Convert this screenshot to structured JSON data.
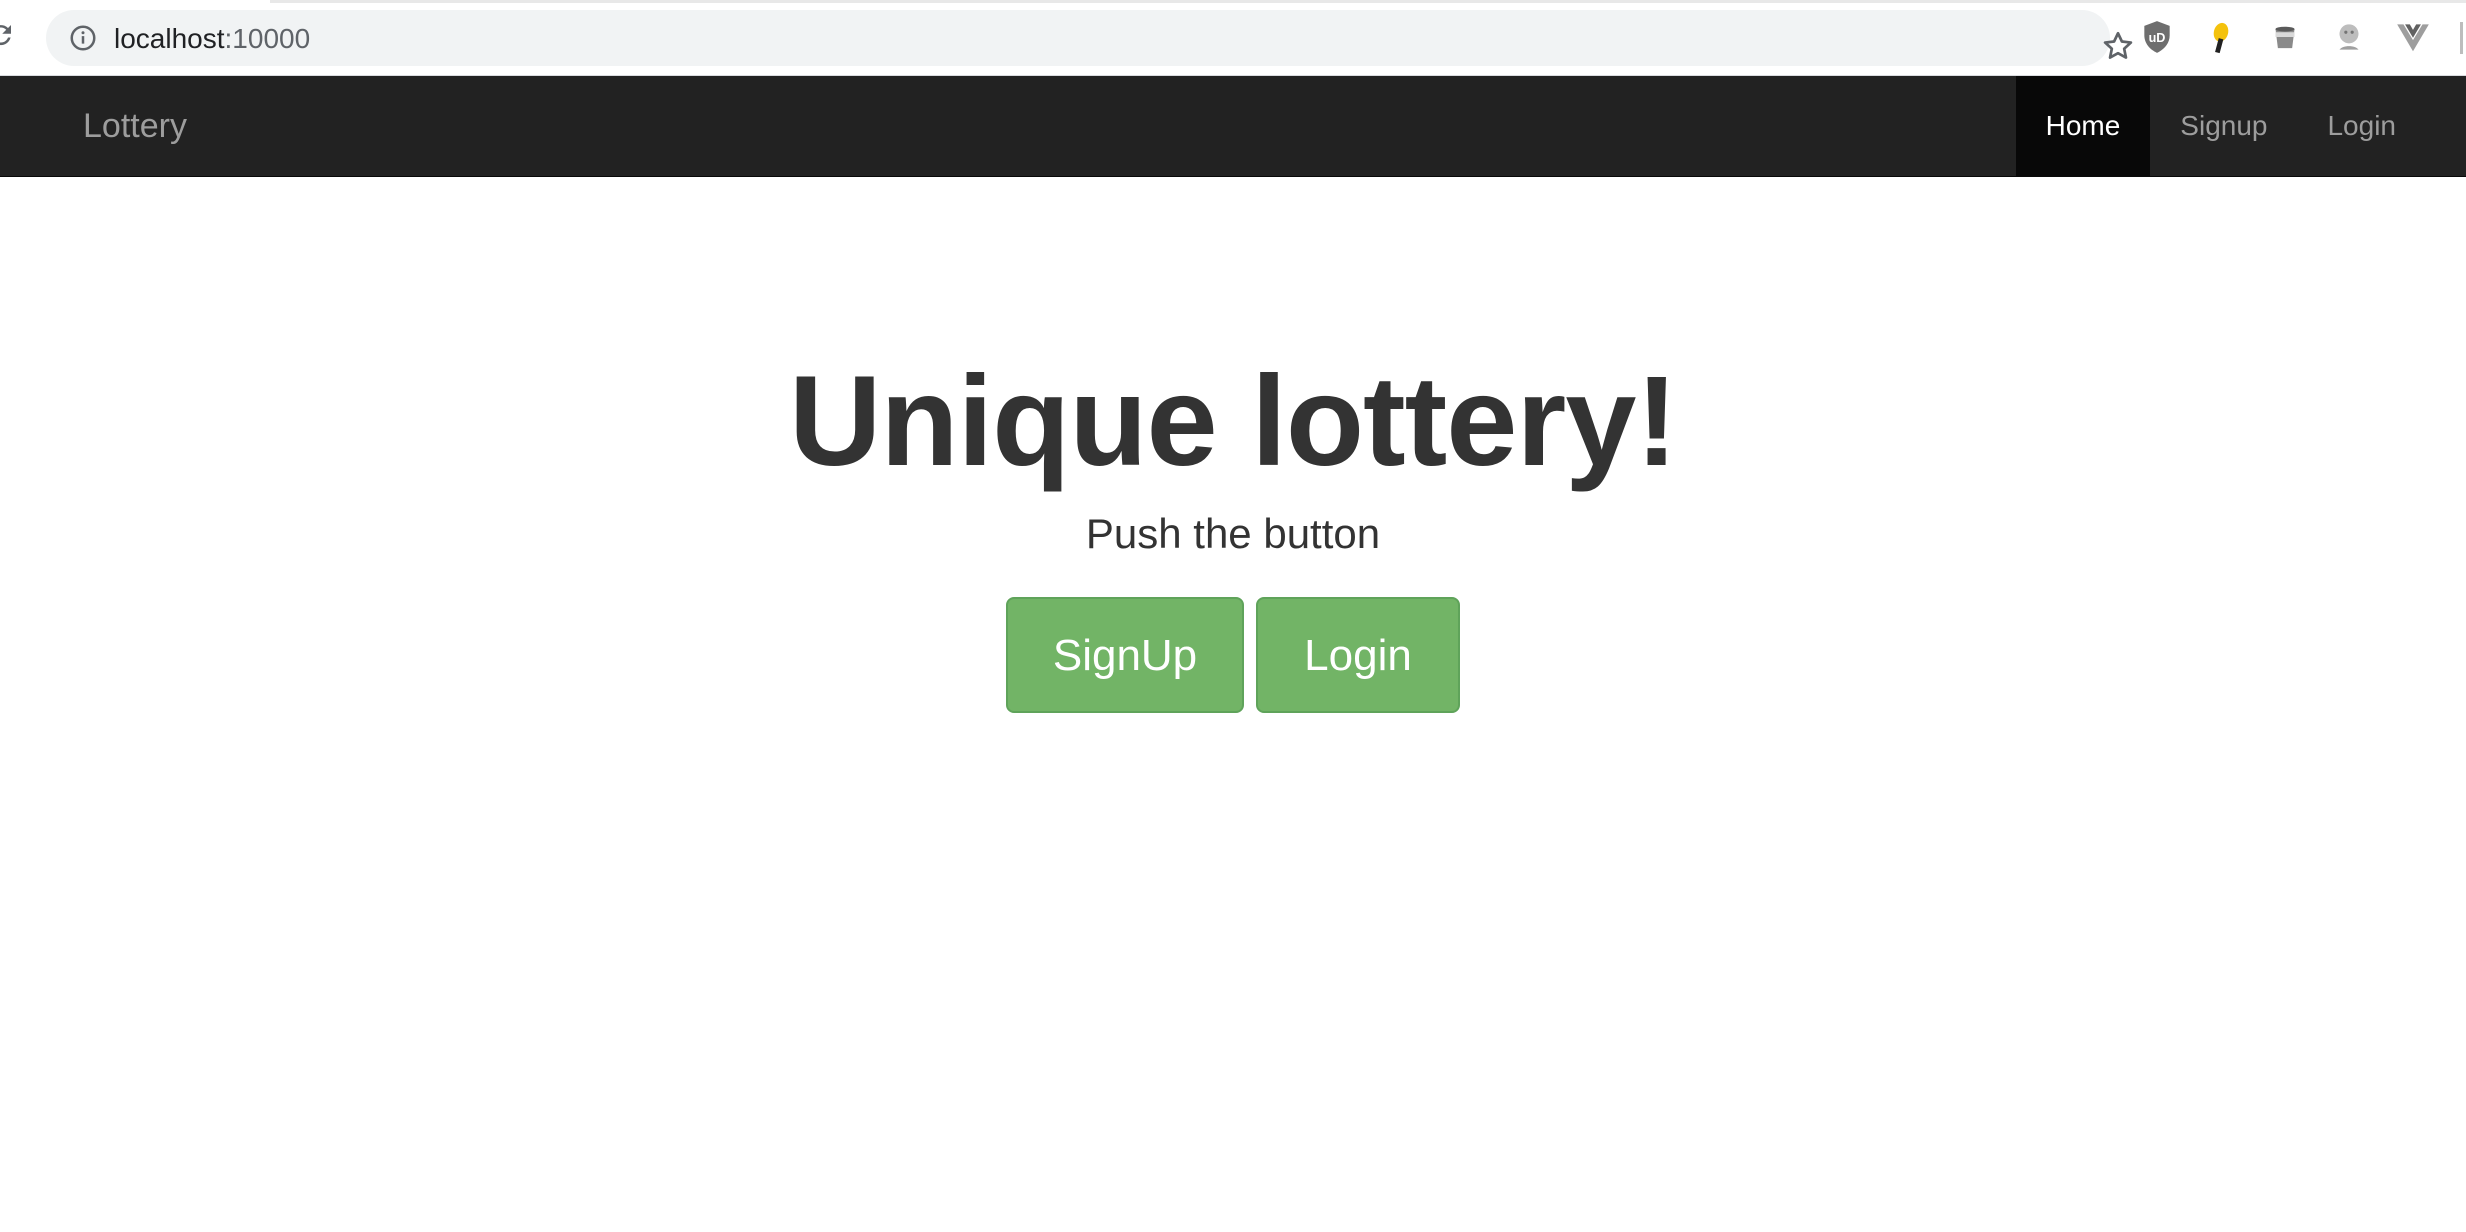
{
  "browser": {
    "url_host": "localhost",
    "url_port": ":10000",
    "extensions": [
      "ublock-origin-icon",
      "bulb-icon",
      "cup-icon",
      "face-icon",
      "vue-devtools-icon"
    ]
  },
  "navbar": {
    "brand": "Lottery",
    "items": [
      {
        "label": "Home",
        "active": true
      },
      {
        "label": "Signup",
        "active": false
      },
      {
        "label": "Login",
        "active": false
      }
    ]
  },
  "hero": {
    "title": "Unique lottery!",
    "subtitle": "Push the button",
    "buttons": {
      "signup": "SignUp",
      "login": "Login"
    }
  },
  "colors": {
    "navbar_bg": "#222222",
    "navbar_active_bg": "#080808",
    "button_green": "#72b466",
    "text_dark": "#333333"
  }
}
